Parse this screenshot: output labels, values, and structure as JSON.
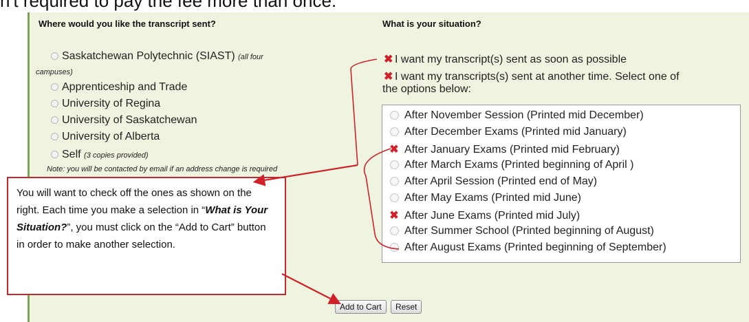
{
  "header_text": "n't required to pay the fee more than once.",
  "left": {
    "heading": "Where would you like the transcript sent?",
    "options": [
      {
        "label": "Saskatchewan Polytechnic (SIAST)",
        "suffix": "(all four"
      },
      {
        "label": "Apprenticeship and Trade"
      },
      {
        "label": "University of Regina"
      },
      {
        "label": "University of Saskatchewan"
      },
      {
        "label": "University of Alberta"
      },
      {
        "label": "Self",
        "suffix": "(3 copies provided)"
      }
    ],
    "campuses_continuation": "campuses)",
    "note": "Note: you will be contacted by email if an address change is required"
  },
  "right": {
    "heading": "What is your situation?",
    "choice_asap": "I want my transcript(s) sent as soon as possible",
    "choice_other_line1": "I want my transcripts(s) sent at another time. Select one of",
    "choice_other_line2": "the options below:",
    "sessions": [
      {
        "label": "After November Session (Printed mid December)",
        "checked": false
      },
      {
        "label": "After December Exams (Printed mid January)",
        "checked": false
      },
      {
        "label": "After January Exams (Printed mid February)",
        "checked": true
      },
      {
        "label": "After March Exams (Printed beginning of April )",
        "checked": false
      },
      {
        "label": "After April Session (Printed end of May)",
        "checked": false
      },
      {
        "label": "After May Exams (Printed mid June)",
        "checked": false
      },
      {
        "label": "After June Exams (Printed mid July)",
        "checked": true
      },
      {
        "label": "After Summer School (Printed beginning of August)",
        "checked": false
      },
      {
        "label": "After August Exams (Printed beginning of September)",
        "checked": false
      }
    ]
  },
  "callout": {
    "text_before": "You will want to check off the ones as shown on the right.  Each time you make a selection in “",
    "emphasis": "What is Your Situation?",
    "text_after": "”, you must click on the “Add to Cart” button in order to make another selection."
  },
  "buttons": {
    "add_to_cart": "Add to Cart",
    "reset": "Reset"
  },
  "colors": {
    "panel_bg": "#eef4df",
    "accent_red": "#d0202a",
    "callout_border": "#c8282a"
  }
}
